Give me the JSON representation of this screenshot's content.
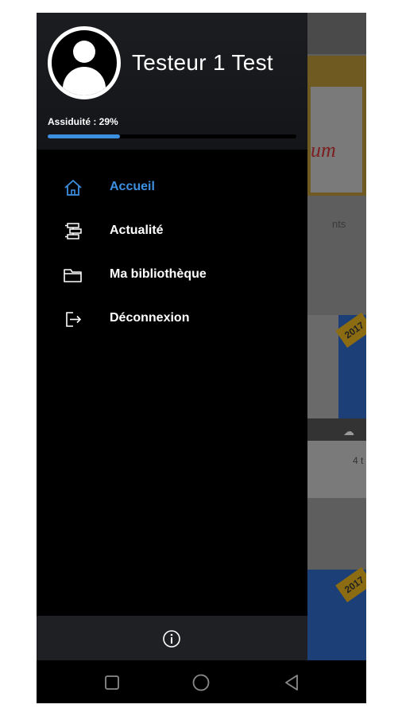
{
  "background_app": {
    "banner_word": "um",
    "section_fragment": "nts",
    "ribbon_year": "2017",
    "card_text_fragment": "4 t"
  },
  "drawer": {
    "user_name": "Testeur 1 Test",
    "attendance_label": "Assiduité : 29%",
    "attendance_progress": 0.29,
    "accent_color": "#3d8fe0",
    "menu": [
      {
        "label": "Accueil",
        "icon": "home-icon",
        "active": true
      },
      {
        "label": "Actualité",
        "icon": "news-icon",
        "active": false
      },
      {
        "label": "Ma bibliothèque",
        "icon": "folder-icon",
        "active": false
      },
      {
        "label": "Déconnexion",
        "icon": "logout-icon",
        "active": false
      }
    ],
    "footer_icon": "info-icon"
  },
  "navbar": {
    "buttons": [
      "recent-apps-icon",
      "home-circle-icon",
      "back-icon"
    ]
  }
}
